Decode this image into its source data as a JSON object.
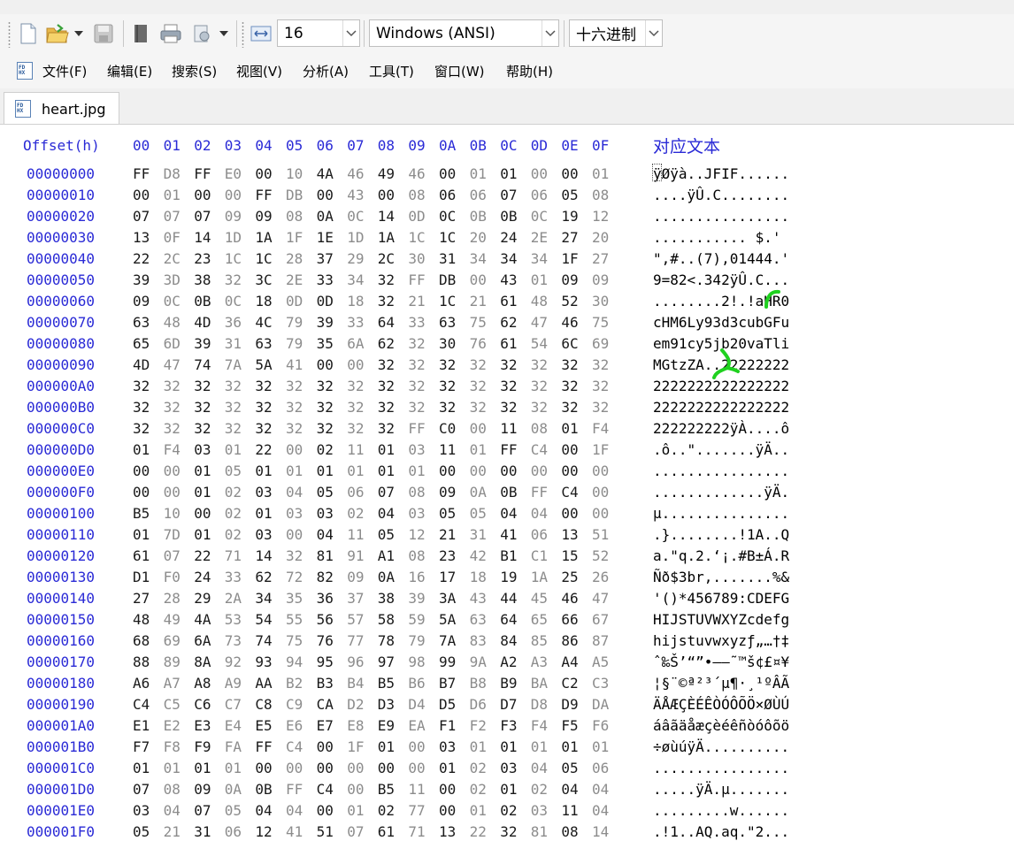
{
  "toolbar": {
    "icons": [
      "new-file-icon",
      "open-folder-icon",
      "dropdown-arrow-icon",
      "save-icon",
      "book-icon",
      "print-icon",
      "export-icon",
      "dropdown-arrow-icon",
      "bytes-per-row-icon"
    ],
    "bytes_per_row": "16",
    "encoding": "Windows (ANSI)",
    "display_base": "十六进制"
  },
  "menu": [
    "文件(F)",
    "编辑(E)",
    "搜索(S)",
    "视图(V)",
    "分析(A)",
    "工具(T)",
    "窗口(W)",
    "帮助(H)"
  ],
  "menu_icon_text": "FD HX",
  "tab": {
    "label": "heart.jpg",
    "icon_text": "FD HX"
  },
  "hex": {
    "offset_header": "Offset(h)",
    "columns": [
      "00",
      "01",
      "02",
      "03",
      "04",
      "05",
      "06",
      "07",
      "08",
      "09",
      "0A",
      "0B",
      "0C",
      "0D",
      "0E",
      "0F"
    ],
    "text_header": "对应文本",
    "rows": [
      {
        "offset": "00000000",
        "bytes": [
          "FF",
          "D8",
          "FF",
          "E0",
          "00",
          "10",
          "4A",
          "46",
          "49",
          "46",
          "00",
          "01",
          "01",
          "00",
          "00",
          "01"
        ],
        "text": "ÿØÿà..JFIF......"
      },
      {
        "offset": "00000010",
        "bytes": [
          "00",
          "01",
          "00",
          "00",
          "FF",
          "DB",
          "00",
          "43",
          "00",
          "08",
          "06",
          "06",
          "07",
          "06",
          "05",
          "08"
        ],
        "text": "....ÿÛ.C........"
      },
      {
        "offset": "00000020",
        "bytes": [
          "07",
          "07",
          "07",
          "09",
          "09",
          "08",
          "0A",
          "0C",
          "14",
          "0D",
          "0C",
          "0B",
          "0B",
          "0C",
          "19",
          "12"
        ],
        "text": "................"
      },
      {
        "offset": "00000030",
        "bytes": [
          "13",
          "0F",
          "14",
          "1D",
          "1A",
          "1F",
          "1E",
          "1D",
          "1A",
          "1C",
          "1C",
          "20",
          "24",
          "2E",
          "27",
          "20"
        ],
        "text": "........... $.' "
      },
      {
        "offset": "00000040",
        "bytes": [
          "22",
          "2C",
          "23",
          "1C",
          "1C",
          "28",
          "37",
          "29",
          "2C",
          "30",
          "31",
          "34",
          "34",
          "34",
          "1F",
          "27"
        ],
        "text": "\",#..(7),01444.'"
      },
      {
        "offset": "00000050",
        "bytes": [
          "39",
          "3D",
          "38",
          "32",
          "3C",
          "2E",
          "33",
          "34",
          "32",
          "FF",
          "DB",
          "00",
          "43",
          "01",
          "09",
          "09"
        ],
        "text": "9=82<.342ÿÛ.C..."
      },
      {
        "offset": "00000060",
        "bytes": [
          "09",
          "0C",
          "0B",
          "0C",
          "18",
          "0D",
          "0D",
          "18",
          "32",
          "21",
          "1C",
          "21",
          "61",
          "48",
          "52",
          "30"
        ],
        "text": "........2!.!aHR0"
      },
      {
        "offset": "00000070",
        "bytes": [
          "63",
          "48",
          "4D",
          "36",
          "4C",
          "79",
          "39",
          "33",
          "64",
          "33",
          "63",
          "75",
          "62",
          "47",
          "46",
          "75"
        ],
        "text": "cHM6Ly93d3cubGFu"
      },
      {
        "offset": "00000080",
        "bytes": [
          "65",
          "6D",
          "39",
          "31",
          "63",
          "79",
          "35",
          "6A",
          "62",
          "32",
          "30",
          "76",
          "61",
          "54",
          "6C",
          "69"
        ],
        "text": "em91cy5jb20vaTli"
      },
      {
        "offset": "00000090",
        "bytes": [
          "4D",
          "47",
          "74",
          "7A",
          "5A",
          "41",
          "00",
          "00",
          "32",
          "32",
          "32",
          "32",
          "32",
          "32",
          "32",
          "32"
        ],
        "text": "MGtzZA..22222222"
      },
      {
        "offset": "000000A0",
        "bytes": [
          "32",
          "32",
          "32",
          "32",
          "32",
          "32",
          "32",
          "32",
          "32",
          "32",
          "32",
          "32",
          "32",
          "32",
          "32",
          "32"
        ],
        "text": "2222222222222222"
      },
      {
        "offset": "000000B0",
        "bytes": [
          "32",
          "32",
          "32",
          "32",
          "32",
          "32",
          "32",
          "32",
          "32",
          "32",
          "32",
          "32",
          "32",
          "32",
          "32",
          "32"
        ],
        "text": "2222222222222222"
      },
      {
        "offset": "000000C0",
        "bytes": [
          "32",
          "32",
          "32",
          "32",
          "32",
          "32",
          "32",
          "32",
          "32",
          "FF",
          "C0",
          "00",
          "11",
          "08",
          "01",
          "F4"
        ],
        "text": "222222222ÿÀ....ô"
      },
      {
        "offset": "000000D0",
        "bytes": [
          "01",
          "F4",
          "03",
          "01",
          "22",
          "00",
          "02",
          "11",
          "01",
          "03",
          "11",
          "01",
          "FF",
          "C4",
          "00",
          "1F"
        ],
        "text": ".ô..\".......ÿÄ.."
      },
      {
        "offset": "000000E0",
        "bytes": [
          "00",
          "00",
          "01",
          "05",
          "01",
          "01",
          "01",
          "01",
          "01",
          "01",
          "00",
          "00",
          "00",
          "00",
          "00",
          "00"
        ],
        "text": "................"
      },
      {
        "offset": "000000F0",
        "bytes": [
          "00",
          "00",
          "01",
          "02",
          "03",
          "04",
          "05",
          "06",
          "07",
          "08",
          "09",
          "0A",
          "0B",
          "FF",
          "C4",
          "00"
        ],
        "text": ".............ÿÄ."
      },
      {
        "offset": "00000100",
        "bytes": [
          "B5",
          "10",
          "00",
          "02",
          "01",
          "03",
          "03",
          "02",
          "04",
          "03",
          "05",
          "05",
          "04",
          "04",
          "00",
          "00"
        ],
        "text": "µ..............."
      },
      {
        "offset": "00000110",
        "bytes": [
          "01",
          "7D",
          "01",
          "02",
          "03",
          "00",
          "04",
          "11",
          "05",
          "12",
          "21",
          "31",
          "41",
          "06",
          "13",
          "51"
        ],
        "text": ".}........!1A..Q"
      },
      {
        "offset": "00000120",
        "bytes": [
          "61",
          "07",
          "22",
          "71",
          "14",
          "32",
          "81",
          "91",
          "A1",
          "08",
          "23",
          "42",
          "B1",
          "C1",
          "15",
          "52"
        ],
        "text": "a.\"q.2.‘¡.#B±Á.R"
      },
      {
        "offset": "00000130",
        "bytes": [
          "D1",
          "F0",
          "24",
          "33",
          "62",
          "72",
          "82",
          "09",
          "0A",
          "16",
          "17",
          "18",
          "19",
          "1A",
          "25",
          "26"
        ],
        "text": "Ñð$3br,.......%&"
      },
      {
        "offset": "00000140",
        "bytes": [
          "27",
          "28",
          "29",
          "2A",
          "34",
          "35",
          "36",
          "37",
          "38",
          "39",
          "3A",
          "43",
          "44",
          "45",
          "46",
          "47"
        ],
        "text": "'()*456789:CDEFG"
      },
      {
        "offset": "00000150",
        "bytes": [
          "48",
          "49",
          "4A",
          "53",
          "54",
          "55",
          "56",
          "57",
          "58",
          "59",
          "5A",
          "63",
          "64",
          "65",
          "66",
          "67"
        ],
        "text": "HIJSTUVWXYZcdefg"
      },
      {
        "offset": "00000160",
        "bytes": [
          "68",
          "69",
          "6A",
          "73",
          "74",
          "75",
          "76",
          "77",
          "78",
          "79",
          "7A",
          "83",
          "84",
          "85",
          "86",
          "87"
        ],
        "text": "hijstuvwxyzƒ„…†‡"
      },
      {
        "offset": "00000170",
        "bytes": [
          "88",
          "89",
          "8A",
          "92",
          "93",
          "94",
          "95",
          "96",
          "97",
          "98",
          "99",
          "9A",
          "A2",
          "A3",
          "A4",
          "A5"
        ],
        "text": "ˆ‰Š’“”•–—˜™š¢£¤¥"
      },
      {
        "offset": "00000180",
        "bytes": [
          "A6",
          "A7",
          "A8",
          "A9",
          "AA",
          "B2",
          "B3",
          "B4",
          "B5",
          "B6",
          "B7",
          "B8",
          "B9",
          "BA",
          "C2",
          "C3"
        ],
        "text": "¦§¨©ª²³´µ¶·¸¹ºÂÃ"
      },
      {
        "offset": "00000190",
        "bytes": [
          "C4",
          "C5",
          "C6",
          "C7",
          "C8",
          "C9",
          "CA",
          "D2",
          "D3",
          "D4",
          "D5",
          "D6",
          "D7",
          "D8",
          "D9",
          "DA"
        ],
        "text": "ÄÅÆÇÈÉÊÒÓÔÕÖ×ØÙÚ"
      },
      {
        "offset": "000001A0",
        "bytes": [
          "E1",
          "E2",
          "E3",
          "E4",
          "E5",
          "E6",
          "E7",
          "E8",
          "E9",
          "EA",
          "F1",
          "F2",
          "F3",
          "F4",
          "F5",
          "F6"
        ],
        "text": "áâãäåæçèéêñòóôõö"
      },
      {
        "offset": "000001B0",
        "bytes": [
          "F7",
          "F8",
          "F9",
          "FA",
          "FF",
          "C4",
          "00",
          "1F",
          "01",
          "00",
          "03",
          "01",
          "01",
          "01",
          "01",
          "01"
        ],
        "text": "÷øùúÿÄ.........."
      },
      {
        "offset": "000001C0",
        "bytes": [
          "01",
          "01",
          "01",
          "01",
          "00",
          "00",
          "00",
          "00",
          "00",
          "00",
          "01",
          "02",
          "03",
          "04",
          "05",
          "06"
        ],
        "text": "................"
      },
      {
        "offset": "000001D0",
        "bytes": [
          "07",
          "08",
          "09",
          "0A",
          "0B",
          "FF",
          "C4",
          "00",
          "B5",
          "11",
          "00",
          "02",
          "01",
          "02",
          "04",
          "04"
        ],
        "text": ".....ÿÄ.µ......."
      },
      {
        "offset": "000001E0",
        "bytes": [
          "03",
          "04",
          "07",
          "05",
          "04",
          "04",
          "00",
          "01",
          "02",
          "77",
          "00",
          "01",
          "02",
          "03",
          "11",
          "04"
        ],
        "text": ".........w......"
      },
      {
        "offset": "000001F0",
        "bytes": [
          "05",
          "21",
          "31",
          "06",
          "12",
          "41",
          "51",
          "07",
          "61",
          "71",
          "13",
          "22",
          "32",
          "81",
          "08",
          "14"
        ],
        "text": ".!1..AQ.aq.\"2..."
      }
    ]
  },
  "colors": {
    "offset": "#2a2ad6",
    "byte": "#1a1a1a",
    "byte_dim": "#8c8c8c",
    "annotation": "#1fd11f"
  }
}
